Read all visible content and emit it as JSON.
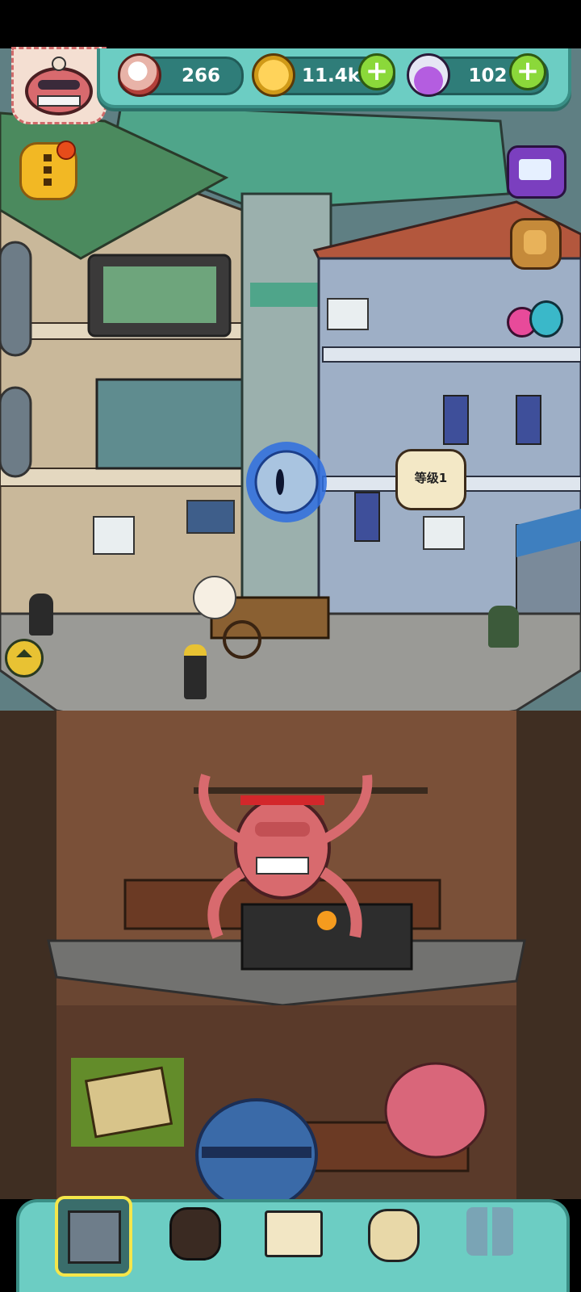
{
  "resources": {
    "eyeball": {
      "icon": "eyeball-icon",
      "value": "266"
    },
    "coins": {
      "icon": "coin-icon",
      "value": "11.4k"
    },
    "potion": {
      "icon": "potion-icon",
      "value": "102"
    }
  },
  "plus_symbol": "+",
  "speech_bubble": {
    "text": "等级1"
  },
  "left_buttons": [
    "menu-icon",
    "home-icon"
  ],
  "right_buttons": [
    "tv-ad-icon",
    "backpack-icon",
    "monster-eggs-icon"
  ],
  "bottom_nav": [
    "building-tab",
    "fire-monster-tab",
    "book-tab",
    "money-bag-tab",
    "monster-grid-tab"
  ],
  "colors": {
    "panel": "#6ccdc3",
    "panel_dark": "#3a8f86",
    "pill": "#2f7d79",
    "plus": "#8bd83a",
    "notification": "#e74c1a"
  }
}
